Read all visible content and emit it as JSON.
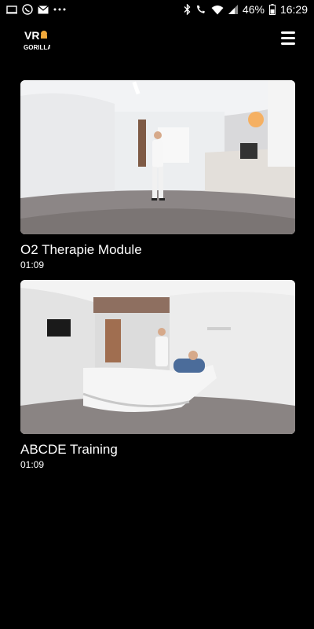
{
  "status_bar": {
    "battery_percent": "46%",
    "time": "16:29",
    "icons": [
      "tablet-icon",
      "whatsapp-icon",
      "mail-icon",
      "more-dots-icon",
      "bluetooth-icon",
      "wifi-call-icon",
      "wifi-icon",
      "signal-icon",
      "battery-icon"
    ]
  },
  "header": {
    "logo_text_top": "VR",
    "logo_text_bottom": "GORILLA",
    "menu_icon": "hamburger-icon"
  },
  "videos": [
    {
      "title": "O2 Therapie Module",
      "duration": "01:09"
    },
    {
      "title": "ABCDE Training",
      "duration": "01:09"
    }
  ]
}
